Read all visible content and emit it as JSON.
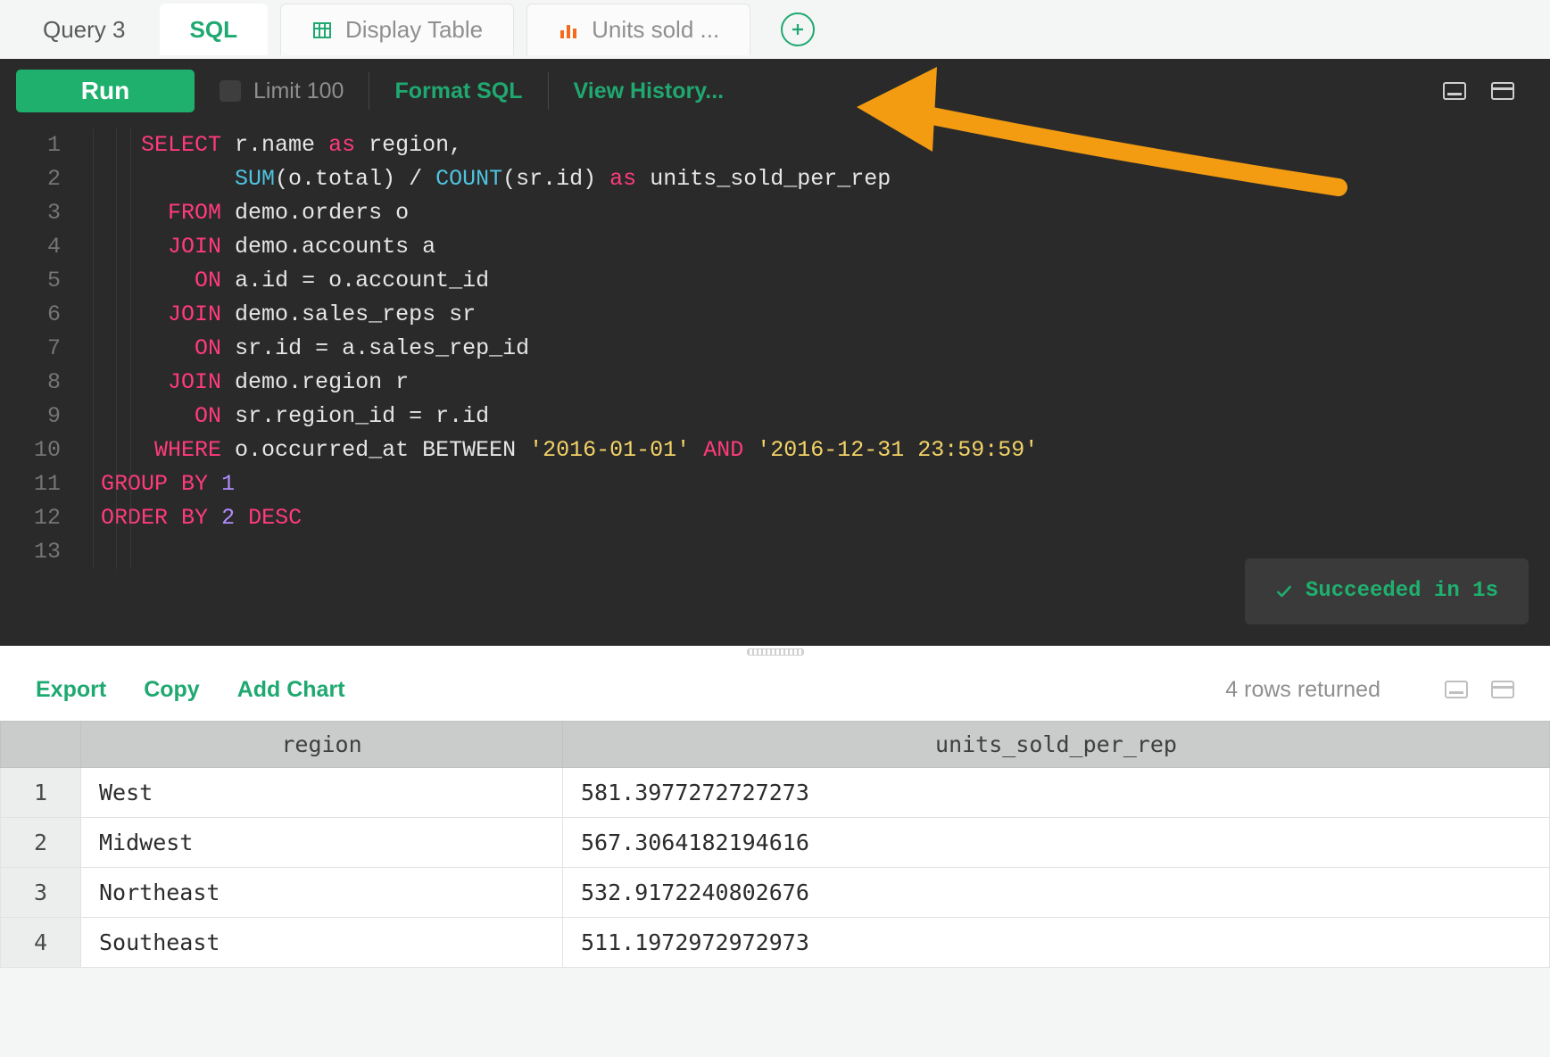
{
  "query_title": "Query 3",
  "tabs": [
    {
      "label": "SQL",
      "icon": null,
      "active": true
    },
    {
      "label": "Display Table",
      "icon": "table",
      "active": false
    },
    {
      "label": "Units sold ...",
      "icon": "bar-chart",
      "active": false
    }
  ],
  "toolbar": {
    "run": "Run",
    "limit_label": "Limit 100",
    "limit_checked": false,
    "format": "Format SQL",
    "history": "View History..."
  },
  "editor": {
    "lines": 13,
    "code_tokens": [
      [
        [
          "    ",
          "pale"
        ],
        [
          "SELECT",
          "kw"
        ],
        [
          " ",
          "pale"
        ],
        [
          "r.name",
          "id"
        ],
        [
          " ",
          "pale"
        ],
        [
          "as",
          "as"
        ],
        [
          " ",
          "pale"
        ],
        [
          "region,",
          "id"
        ]
      ],
      [
        [
          "           ",
          "pale"
        ],
        [
          "SUM",
          "func"
        ],
        [
          "(o.total)",
          "id"
        ],
        [
          " / ",
          "op"
        ],
        [
          "COUNT",
          "func"
        ],
        [
          "(sr.id)",
          "id"
        ],
        [
          " ",
          "pale"
        ],
        [
          "as",
          "as"
        ],
        [
          " ",
          "pale"
        ],
        [
          "units_sold_per_rep",
          "id"
        ]
      ],
      [
        [
          "      ",
          "pale"
        ],
        [
          "FROM",
          "kw"
        ],
        [
          " ",
          "pale"
        ],
        [
          "demo.orders o",
          "id"
        ]
      ],
      [
        [
          "      ",
          "pale"
        ],
        [
          "JOIN",
          "kw"
        ],
        [
          " ",
          "pale"
        ],
        [
          "demo.accounts a",
          "id"
        ]
      ],
      [
        [
          "        ",
          "pale"
        ],
        [
          "ON",
          "kw"
        ],
        [
          " ",
          "pale"
        ],
        [
          "a.id = o.account_id",
          "id"
        ]
      ],
      [
        [
          "      ",
          "pale"
        ],
        [
          "JOIN",
          "kw"
        ],
        [
          " ",
          "pale"
        ],
        [
          "demo.sales_reps sr",
          "id"
        ]
      ],
      [
        [
          "        ",
          "pale"
        ],
        [
          "ON",
          "kw"
        ],
        [
          " ",
          "pale"
        ],
        [
          "sr.id = a.sales_rep_id",
          "id"
        ]
      ],
      [
        [
          "      ",
          "pale"
        ],
        [
          "JOIN",
          "kw"
        ],
        [
          " ",
          "pale"
        ],
        [
          "demo.region r",
          "id"
        ]
      ],
      [
        [
          "        ",
          "pale"
        ],
        [
          "ON",
          "kw"
        ],
        [
          " ",
          "pale"
        ],
        [
          "sr.region_id = r.id",
          "id"
        ]
      ],
      [
        [
          "     ",
          "pale"
        ],
        [
          "WHERE",
          "kw"
        ],
        [
          " ",
          "pale"
        ],
        [
          "o.occurred_at ",
          "id"
        ],
        [
          "BETWEEN",
          "id"
        ],
        [
          " ",
          "pale"
        ],
        [
          "'2016-01-01'",
          "str"
        ],
        [
          " ",
          "pale"
        ],
        [
          "AND",
          "kw2"
        ],
        [
          " ",
          "pale"
        ],
        [
          "'2016-12-31 23:59:59'",
          "str"
        ]
      ],
      [
        [
          " ",
          "pale"
        ],
        [
          "GROUP",
          "kw"
        ],
        [
          " ",
          "pale"
        ],
        [
          "BY",
          "kw"
        ],
        [
          " ",
          "pale"
        ],
        [
          "1",
          "num"
        ]
      ],
      [
        [
          " ",
          "pale"
        ],
        [
          "ORDER",
          "kw"
        ],
        [
          " ",
          "pale"
        ],
        [
          "BY",
          "kw"
        ],
        [
          " ",
          "pale"
        ],
        [
          "2",
          "num"
        ],
        [
          " ",
          "pale"
        ],
        [
          "DESC",
          "kw"
        ]
      ],
      [
        [
          "",
          "pale"
        ]
      ]
    ]
  },
  "status": "Succeeded in 1s",
  "results_toolbar": {
    "export": "Export",
    "copy": "Copy",
    "add_chart": "Add Chart",
    "rows_returned": "4 rows returned"
  },
  "results": {
    "columns": [
      "region",
      "units_sold_per_rep"
    ],
    "rows": [
      [
        "West",
        "581.3977272727273"
      ],
      [
        "Midwest",
        "567.3064182194616"
      ],
      [
        "Northeast",
        "532.9172240802676"
      ],
      [
        "Southeast",
        "511.1972972972973"
      ]
    ]
  },
  "annotation": {
    "type": "arrow",
    "color": "#f39c12"
  }
}
